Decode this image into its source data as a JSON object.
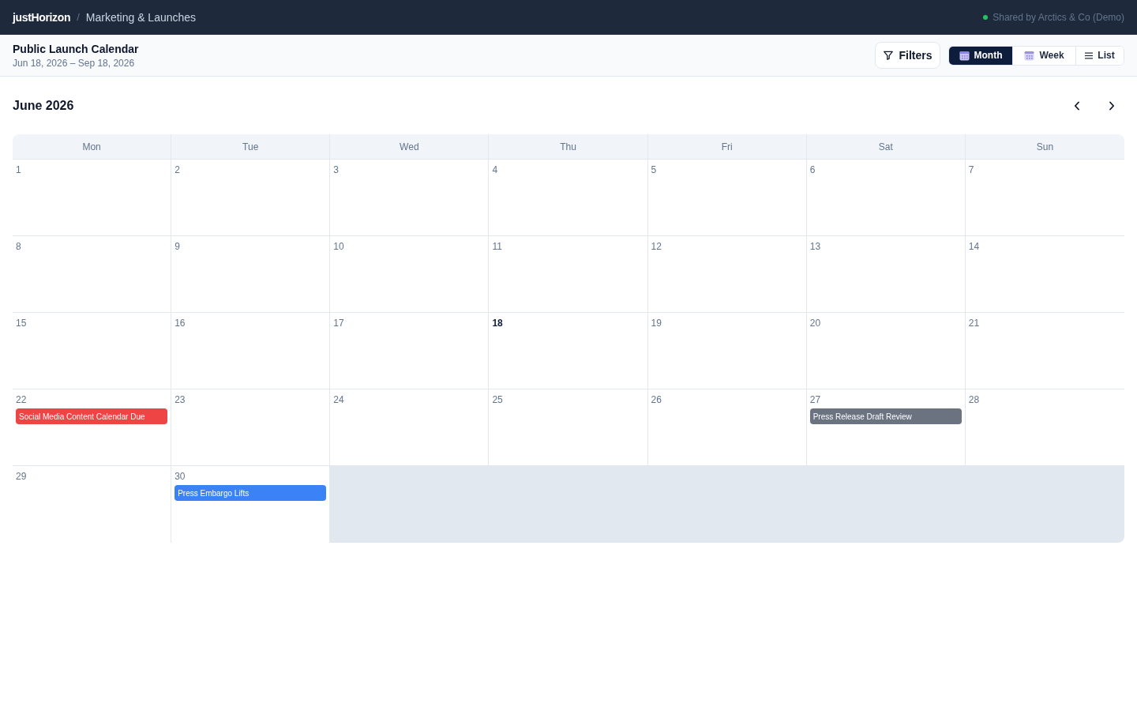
{
  "top_bar": {
    "brand": "justHorizon",
    "separator": "/",
    "section": "Marketing & Launches",
    "shared_label": "Shared by Arctics & Co (Demo)"
  },
  "header": {
    "title": "Public Launch Calendar",
    "date_range": "Jun 18, 2026 – Sep 18, 2026",
    "filters_button": "Filters",
    "views": [
      {
        "label": "Month",
        "kind": "calendar",
        "selected": true
      },
      {
        "label": "Week",
        "kind": "calendar",
        "selected": false
      },
      {
        "label": "List",
        "kind": "list",
        "selected": false
      }
    ]
  },
  "calendar": {
    "month_title": "June 2026",
    "weekdays": [
      "Mon",
      "Tue",
      "Wed",
      "Thu",
      "Fri",
      "Sat",
      "Sun"
    ],
    "weeks": [
      {
        "days": [
          {
            "day": "1",
            "today": false
          },
          {
            "day": "2",
            "today": false
          },
          {
            "day": "3",
            "today": false
          },
          {
            "day": "4",
            "today": false
          },
          {
            "day": "5",
            "today": false
          },
          {
            "day": "6",
            "today": false
          },
          {
            "day": "7",
            "today": false
          }
        ]
      },
      {
        "days": [
          {
            "day": "8",
            "today": false
          },
          {
            "day": "9",
            "today": false
          },
          {
            "day": "10",
            "today": false
          },
          {
            "day": "11",
            "today": false
          },
          {
            "day": "12",
            "today": false
          },
          {
            "day": "13",
            "today": false
          },
          {
            "day": "14",
            "today": false
          }
        ]
      },
      {
        "days": [
          {
            "day": "15",
            "today": false
          },
          {
            "day": "16",
            "today": false
          },
          {
            "day": "17",
            "today": false
          },
          {
            "day": "18",
            "today": true
          },
          {
            "day": "19",
            "today": false
          },
          {
            "day": "20",
            "today": false
          },
          {
            "day": "21",
            "today": false
          }
        ]
      },
      {
        "days": [
          {
            "day": "22",
            "today": false,
            "events": [
              {
                "title": "Social Media Content Calendar Due",
                "color": "#ef4444"
              }
            ]
          },
          {
            "day": "23",
            "today": false
          },
          {
            "day": "24",
            "today": false
          },
          {
            "day": "25",
            "today": false
          },
          {
            "day": "26",
            "today": false
          },
          {
            "day": "27",
            "today": false,
            "events": [
              {
                "title": "Press Release Draft Review",
                "color": "#6b7280"
              }
            ]
          },
          {
            "day": "28",
            "today": false
          }
        ]
      },
      {
        "days": [
          {
            "day": "29",
            "today": false
          },
          {
            "day": "30",
            "today": false,
            "events": [
              {
                "title": "Press Embargo Lifts",
                "color": "#3b82f6"
              }
            ]
          }
        ]
      }
    ]
  }
}
